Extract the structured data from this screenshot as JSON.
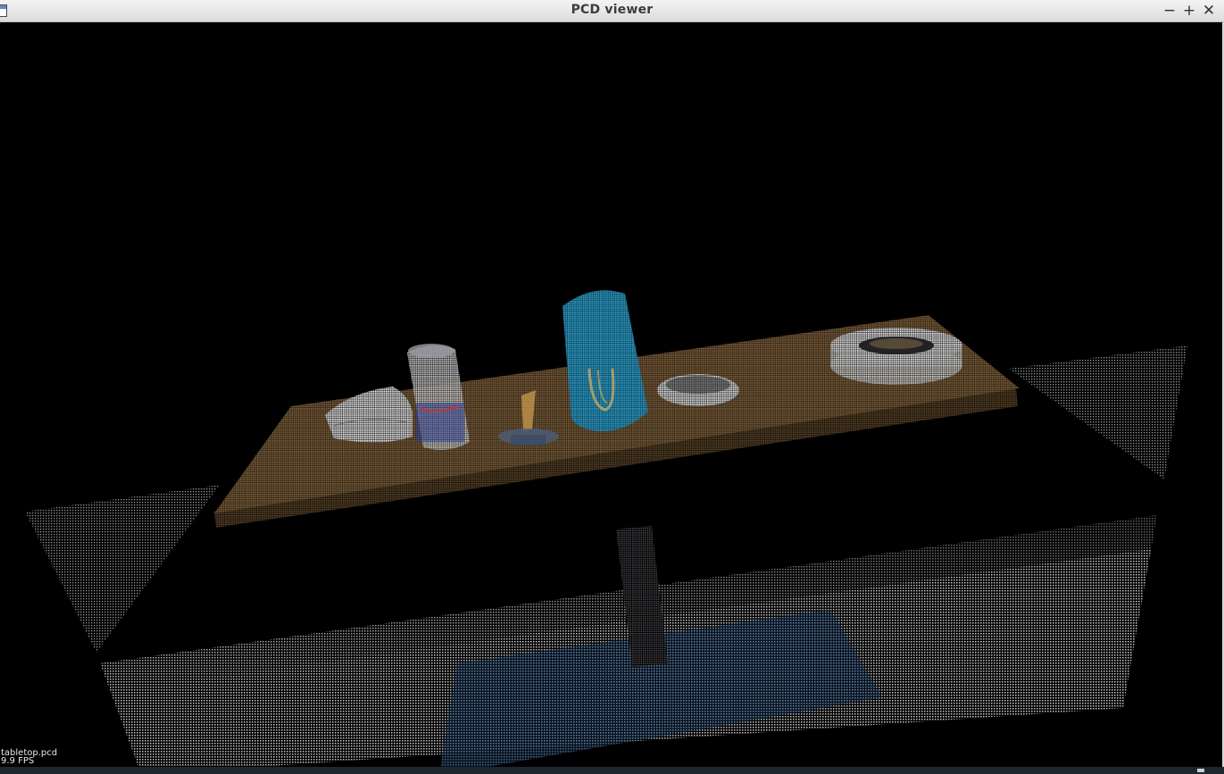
{
  "window": {
    "title": "PCD viewer",
    "controls": {
      "minimize": "−",
      "maximize": "+",
      "close": "✕"
    }
  },
  "viewport": {
    "background_color": "#000000",
    "overlay": {
      "filename": "tabletop.pcd",
      "fps": "9.9 FPS"
    },
    "objects": [
      {
        "name": "tabletop-surface",
        "color": "#7c5f3b"
      },
      {
        "name": "white-mug",
        "color": "#e8e8ea"
      },
      {
        "name": "redbull-can",
        "color": "#b8b8c4"
      },
      {
        "name": "small-figure",
        "color": "#c8a050"
      },
      {
        "name": "blue-can",
        "color": "#2e9bc4"
      },
      {
        "name": "white-bowl",
        "color": "#e4e4e4"
      },
      {
        "name": "roll-tape",
        "color": "#c4c4c4"
      },
      {
        "name": "floor-plane",
        "color": "#a8a8a8"
      },
      {
        "name": "left-wall-patch",
        "color": "#9a9a9a"
      },
      {
        "name": "right-wall-patch",
        "color": "#a0a0a0"
      },
      {
        "name": "table-leg",
        "color": "#3a3a3e"
      },
      {
        "name": "floor-shadow",
        "color": "#3a6aa6"
      }
    ]
  }
}
